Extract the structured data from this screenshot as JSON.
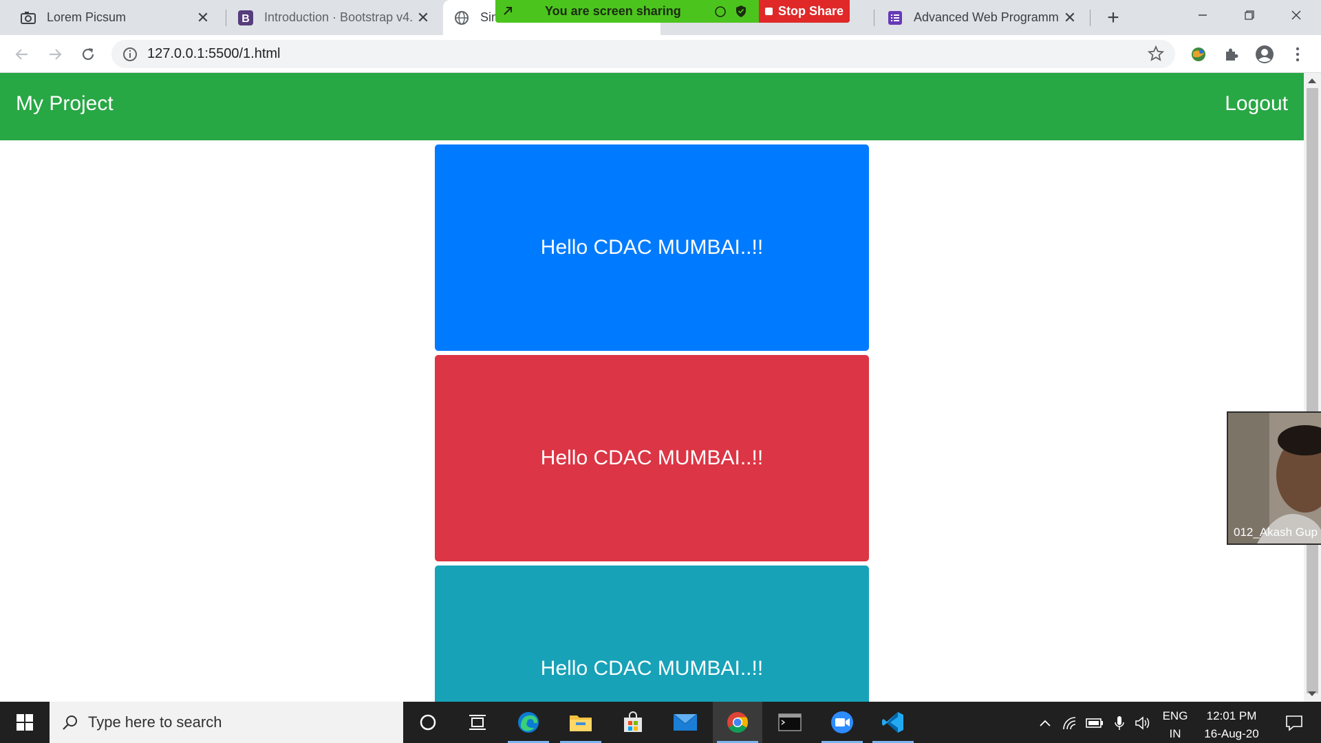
{
  "browser": {
    "tabs": [
      {
        "title": "Lorem Picsum",
        "icon": "camera-icon",
        "active": false
      },
      {
        "title": "Introduction · Bootstrap v4.",
        "icon": "bootstrap-icon",
        "active": false
      },
      {
        "title": "Sin",
        "icon": "globe-icon",
        "active": true
      },
      {
        "title": "Advanced Web Programmi",
        "icon": "forms-icon",
        "active": false
      }
    ],
    "new_tab_symbol": "+",
    "url": "127.0.0.1:5500/1.html"
  },
  "share_banner": {
    "text": "You are screen sharing",
    "stop_label": "Stop Share"
  },
  "page": {
    "brand": "My Project",
    "logout": "Logout",
    "boxes": [
      {
        "text": "Hello CDAC MUMBAI..!!",
        "color": "#007bff"
      },
      {
        "text": "Hello CDAC MUMBAI..!!",
        "color": "#dc3545"
      },
      {
        "text": "Hello CDAC MUMBAI..!!",
        "color": "#17a2b8"
      }
    ],
    "navbar_color": "#28a745"
  },
  "webcam": {
    "label": "012_Akash Gup"
  },
  "taskbar": {
    "search_placeholder": "Type here to search",
    "lang_line1": "ENG",
    "lang_line2": "IN",
    "time": "12:01 PM",
    "date": "16-Aug-20"
  }
}
